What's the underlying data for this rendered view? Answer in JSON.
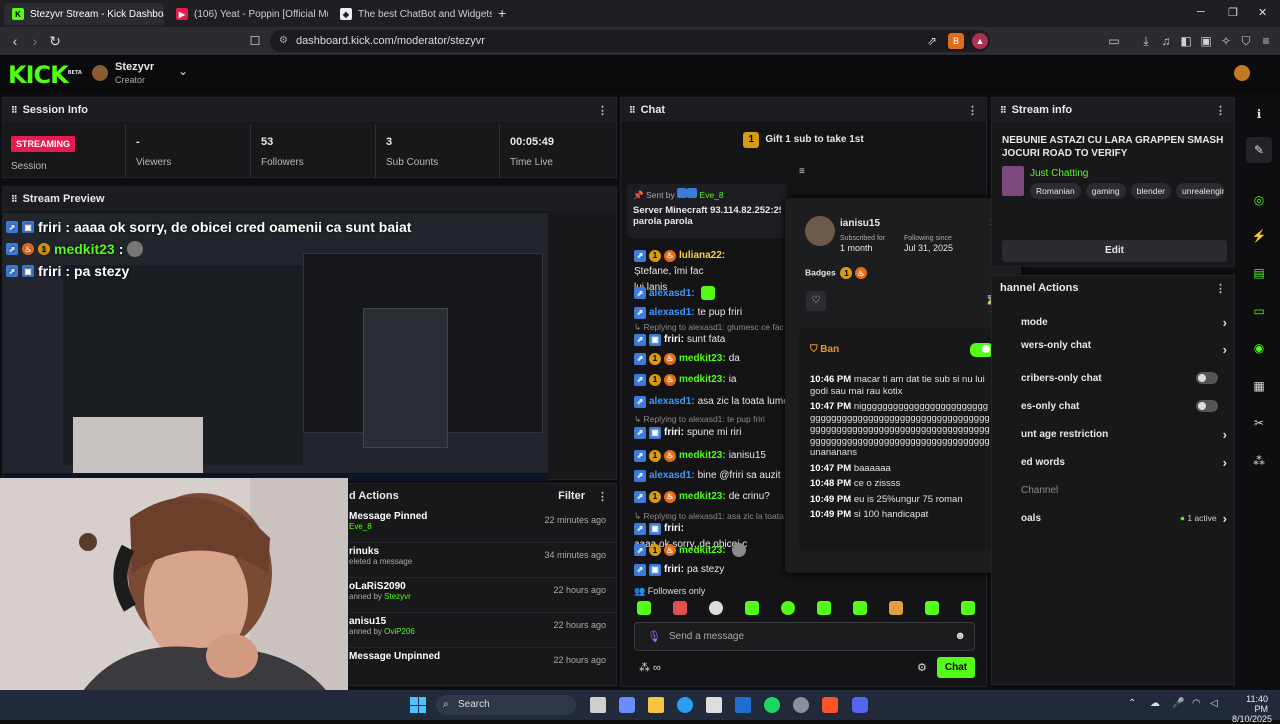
{
  "browser": {
    "tabs": [
      {
        "title": "Stezyvr Stream - Kick Dashboard",
        "favicon": "kick-icon",
        "active": true
      },
      {
        "title": "(106) Yeat - Poppin [Official Musi",
        "favicon": "youtube-icon",
        "active": false
      },
      {
        "title": "The best ChatBot and Widgets for Ki",
        "favicon": "botrix-icon",
        "active": false
      }
    ],
    "new_tab_label": "+",
    "url": "dashboard.kick.com/moderator/stezyvr",
    "window_controls": [
      "─",
      "❐",
      "✕"
    ]
  },
  "header": {
    "logo": "KICK",
    "logo_tag": "BETA",
    "channel_name": "Stezyvr",
    "channel_role": "Creator"
  },
  "session_info": {
    "title": "Session Info",
    "status_badge": "STREAMING",
    "session_label": "Session",
    "stats": [
      {
        "value": "-",
        "label": "Viewers"
      },
      {
        "value": "53",
        "label": "Followers"
      },
      {
        "value": "3",
        "label": "Sub Counts"
      },
      {
        "value": "00:05:49",
        "label": "Time Live"
      }
    ]
  },
  "stream_preview": {
    "title": "Stream Preview",
    "overlay_lines": [
      {
        "user": "friri",
        "text": "aaaa ok sorry, de obicei cred oamenii ca sunt baiat"
      },
      {
        "user": "medkit23",
        "text": ""
      },
      {
        "user": "friri",
        "text": "pa stezy"
      }
    ]
  },
  "mod_actions": {
    "title": "d Actions",
    "filter_label": "Filter",
    "items": [
      {
        "title": "Message Pinned",
        "sub_prefix": "",
        "sub_user": "Eve_8",
        "time": "22 minutes ago"
      },
      {
        "title": "rinuks",
        "sub_prefix": "eleted a message",
        "sub_user": "",
        "time": "34 minutes ago"
      },
      {
        "title": "oLaRiS2090",
        "sub_prefix": "anned by ",
        "sub_user": "Stezyvr",
        "time": "22 hours ago"
      },
      {
        "title": "anisu15",
        "sub_prefix": "anned by ",
        "sub_user": "OviP206",
        "time": "22 hours ago"
      },
      {
        "title": "Message Unpinned",
        "sub_prefix": "",
        "sub_user": "",
        "time": "22 hours ago"
      }
    ]
  },
  "chat": {
    "title": "Chat",
    "gift_banner": "Gift 1 sub to take 1st",
    "gift_count": "1",
    "pinned": {
      "sent_by_label": "Sent by",
      "sent_by_user": "Eve_8",
      "text": "Server Minecraft 93.114.82.252:25",
      "text2": "parola parola"
    },
    "messages": [
      {
        "user": "luliana22",
        "color": "#ffd23e",
        "text": "Ștefane, îmi fac",
        "text2": "lui lanis",
        "badges": [
          "mod",
          "gold",
          "fire"
        ]
      },
      {
        "user": "alexasd1",
        "color": "#3c9bff",
        "text": "",
        "badges": [
          "mod"
        ]
      },
      {
        "user": "alexasd1",
        "color": "#3c9bff",
        "text": "te pup friri",
        "badges": [
          "mod"
        ]
      },
      {
        "reply": "Replying to alexasd1: glumesc ce fac"
      },
      {
        "user": "friri",
        "color": "#ffffff",
        "text": "sunt fata",
        "badges": [
          "mod",
          "blue"
        ]
      },
      {
        "user": "medkit23",
        "color": "#53fc18",
        "text": "da",
        "badges": [
          "mod",
          "gold",
          "fire"
        ]
      },
      {
        "user": "medkit23",
        "color": "#53fc18",
        "text": "ia",
        "badges": [
          "mod",
          "gold",
          "fire"
        ]
      },
      {
        "user": "alexasd1",
        "color": "#3c9bff",
        "text": "asa zic la toata lume",
        "badges": [
          "mod"
        ]
      },
      {
        "reply": "Replying to alexasd1: te pup friri"
      },
      {
        "user": "friri",
        "color": "#ffffff",
        "text": "spune mi riri",
        "badges": [
          "mod",
          "blue"
        ]
      },
      {
        "user": "medkit23",
        "color": "#53fc18",
        "text": "ianisu15",
        "badges": [
          "mod",
          "gold",
          "fire"
        ]
      },
      {
        "user": "alexasd1",
        "color": "#3c9bff",
        "text": "bine @friri sa auzit",
        "badges": [
          "mod"
        ]
      },
      {
        "user": "medkit23",
        "color": "#53fc18",
        "text": "de crinu?",
        "badges": [
          "mod",
          "gold",
          "fire"
        ]
      },
      {
        "reply": "Replying to alexasd1: asa zic la toata lumea"
      },
      {
        "user": "friri",
        "color": "#ffffff",
        "text": "aaaa ok sorry, de obicei c",
        "badges": [
          "mod",
          "blue"
        ]
      },
      {
        "user": "medkit23",
        "color": "#53fc18",
        "text": "",
        "badges": [
          "mod",
          "gold",
          "fire"
        ]
      },
      {
        "user": "friri",
        "color": "#ffffff",
        "text": "pa stezy",
        "badges": [
          "mod",
          "blue"
        ]
      }
    ],
    "followers_only_label": "Followers only",
    "input_placeholder": "Send a message",
    "send_label": "Chat"
  },
  "user_card": {
    "username": "ianisu15",
    "subscribed_label": "Subscribed for",
    "subscribed_value": "1 month",
    "following_label": "Following since",
    "following_value": "Jul 31, 2025",
    "badges_label": "Badges",
    "ban_label": "Ban",
    "log": [
      {
        "time": "10:46 PM",
        "text": "macar ti am dat tie sub si nu lui godi sau mai rau kotix"
      },
      {
        "time": "10:47 PM",
        "text": "niggggggggggggggggggggggggggggggggggggggggggggggggggggggggggggggggggggggggggggggggggggggggggggggggggggggggggggggggggggggggggggggunananans"
      },
      {
        "time": "10:47 PM",
        "text": "baaaaaa"
      },
      {
        "time": "10:48 PM",
        "text": "ce o zissss"
      },
      {
        "time": "10:49 PM",
        "text": "eu is 25%ungur 75 roman"
      },
      {
        "time": "10:49 PM",
        "text": "si 100 handicapat"
      }
    ]
  },
  "stream_info": {
    "title": "Stream info",
    "stream_title": "NEBUNIE ASTAZI CU LARA GRAPPEN SMASH JOCURI ROAD TO VERIFY",
    "category": "Just Chatting",
    "tags": [
      "Romanian",
      "gaming",
      "blender",
      "unrealengine"
    ],
    "edit_label": "Edit"
  },
  "channel_actions": {
    "title": "hannel Actions",
    "rows": [
      {
        "label": "mode",
        "control": "chevron"
      },
      {
        "label": "wers-only chat",
        "control": "chevron"
      },
      {
        "label": "cribers-only chat",
        "control": "toggle"
      },
      {
        "label": "es-only chat",
        "control": "toggle"
      },
      {
        "label": "unt age restriction",
        "control": "chevron"
      },
      {
        "label": "ed words",
        "control": "chevron"
      },
      {
        "label": "Channel",
        "control": "none"
      },
      {
        "label": "oals",
        "control": "active"
      }
    ],
    "active_label": "1 active"
  },
  "taskbar": {
    "search_label": "Search",
    "time": "11:40 PM",
    "date": "8/10/2025"
  },
  "colors": {
    "kick_green": "#53fc18",
    "live_red": "#e51b4e",
    "panel": "#18181b",
    "background": "#0e0e10"
  }
}
